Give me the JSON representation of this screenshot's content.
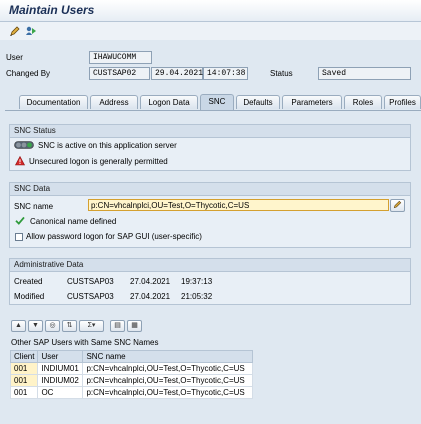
{
  "window": {
    "title": "Maintain Users"
  },
  "toolbar": {
    "items": [
      "change-display-icon",
      "other-user-icon"
    ]
  },
  "header": {
    "user_label": "User",
    "user_value": "IHAWUCOMM",
    "changed_by_label": "Changed By",
    "changed_by_value": "CUSTSAP02",
    "changed_date": "29.04.2021",
    "changed_time": "14:07:38",
    "status_label": "Status",
    "status_value": "Saved"
  },
  "tabs": [
    {
      "label": "Documentation",
      "active": false
    },
    {
      "label": "Address",
      "active": false
    },
    {
      "label": "Logon Data",
      "active": false
    },
    {
      "label": "SNC",
      "active": true
    },
    {
      "label": "Defaults",
      "active": false
    },
    {
      "label": "Parameters",
      "active": false
    },
    {
      "label": "Roles",
      "active": false
    },
    {
      "label": "Profiles",
      "active": false
    }
  ],
  "snc_status": {
    "title": "SNC Status",
    "line1": "SNC is active on this application server",
    "line2": "Unsecured logon is generally permitted"
  },
  "snc_data": {
    "title": "SNC Data",
    "name_label": "SNC name",
    "name_value": "p:CN=vhcalnplci,OU=Test,O=Thycotic,C=US",
    "canonical_text": "Canonical name defined",
    "allow_password_label": "Allow password logon for SAP GUI (user-specific)",
    "allow_password_checked": false
  },
  "admin": {
    "title": "Administrative Data",
    "created_label": "Created",
    "created_by": "CUSTSAP03",
    "created_date": "27.04.2021",
    "created_time": "19:37:13",
    "modified_label": "Modified",
    "modified_by": "CUSTSAP03",
    "modified_date": "27.04.2021",
    "modified_time": "21:05:32"
  },
  "other_users": {
    "title": "Other SAP Users with Same SNC Names",
    "columns": [
      "Client",
      "User",
      "SNC name"
    ],
    "rows": [
      [
        "001",
        "INDIUM01",
        "p:CN=vhcalnplci,OU=Test,O=Thycotic,C=US"
      ],
      [
        "001",
        "INDIUM02",
        "p:CN=vhcalnplci,OU=Test,O=Thycotic,C=US"
      ],
      [
        "001",
        "OC",
        "p:CN=vhcalnplci,OU=Test,O=Thycotic,C=US"
      ]
    ]
  },
  "colors": {
    "accent": "#1a2f56",
    "status_green": "#3aa64a",
    "warning_red": "#d42a2a",
    "input_highlight": "#fff5cc"
  }
}
